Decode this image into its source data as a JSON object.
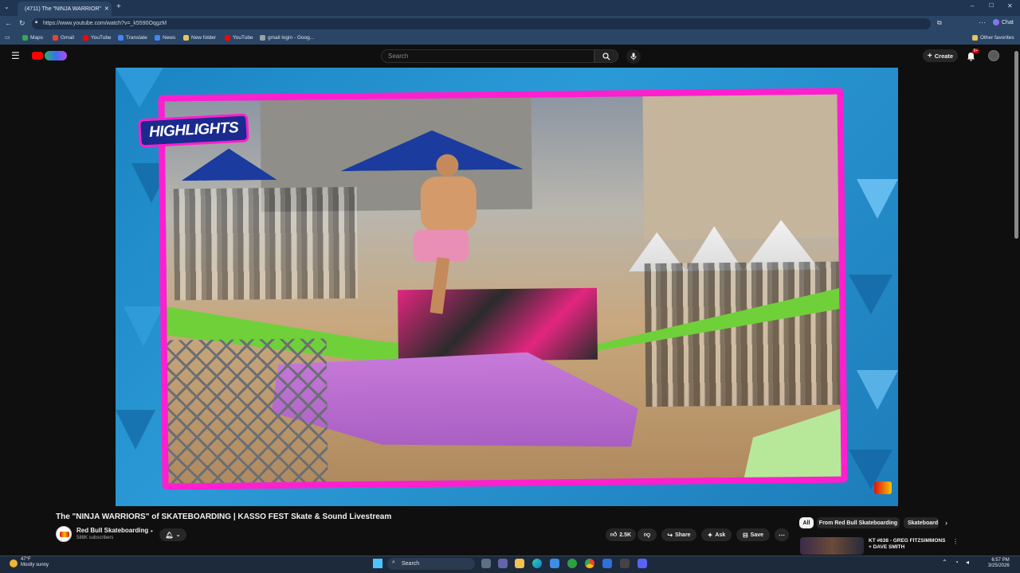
{
  "browser": {
    "tab_title": "(4711) The \"NINJA WARRIOR\"",
    "url": "https://www.youtube.com/watch?v=_k5590OqgzM",
    "favorites": [
      {
        "label": "Maps",
        "color": "#34a853"
      },
      {
        "label": "Gmail",
        "color": "#ea4335"
      },
      {
        "label": "YouTube",
        "color": "#ff0000"
      },
      {
        "label": "Translate",
        "color": "#4285f4"
      },
      {
        "label": "News",
        "color": "#4285f4"
      },
      {
        "label": "New folder",
        "color": "#e8c35a"
      },
      {
        "label": "YouTube",
        "color": "#ff0000"
      },
      {
        "label": "gmail login - Goog...",
        "color": "#9aa0a6"
      }
    ],
    "other_favorites": "Other favorites",
    "copilot_label": "Chat"
  },
  "youtube": {
    "search_placeholder": "Search",
    "create_label": "Create",
    "notifications_badge": "9+"
  },
  "video": {
    "overlay_text": "HIGHLIGHTS",
    "title": "The \"NINJA WARRIORS\" of SKATEBOARDING | KASSO FEST Skate & Sound Livestream",
    "channel": "Red Bull Skateboarding",
    "subscribers": "588K subscribers",
    "likes": "2.5K",
    "share_label": "Share",
    "ask_label": "Ask",
    "save_label": "Save"
  },
  "recommendations": {
    "chips": [
      "All",
      "From Red Bull Skateboarding",
      "Skateboard"
    ],
    "first_title": "KT #638 - GREG FITZSIMMONS + DAVE SMITH"
  },
  "taskbar": {
    "weather_temp": "47°F",
    "weather_desc": "Mostly sunny",
    "search_label": "Search",
    "time": "6:57 PM",
    "date": "3/25/2026"
  },
  "colors": {
    "accent_pink": "#ff1fcf",
    "youtube_red": "#ff0000",
    "player_blue": "#1b84c2"
  }
}
